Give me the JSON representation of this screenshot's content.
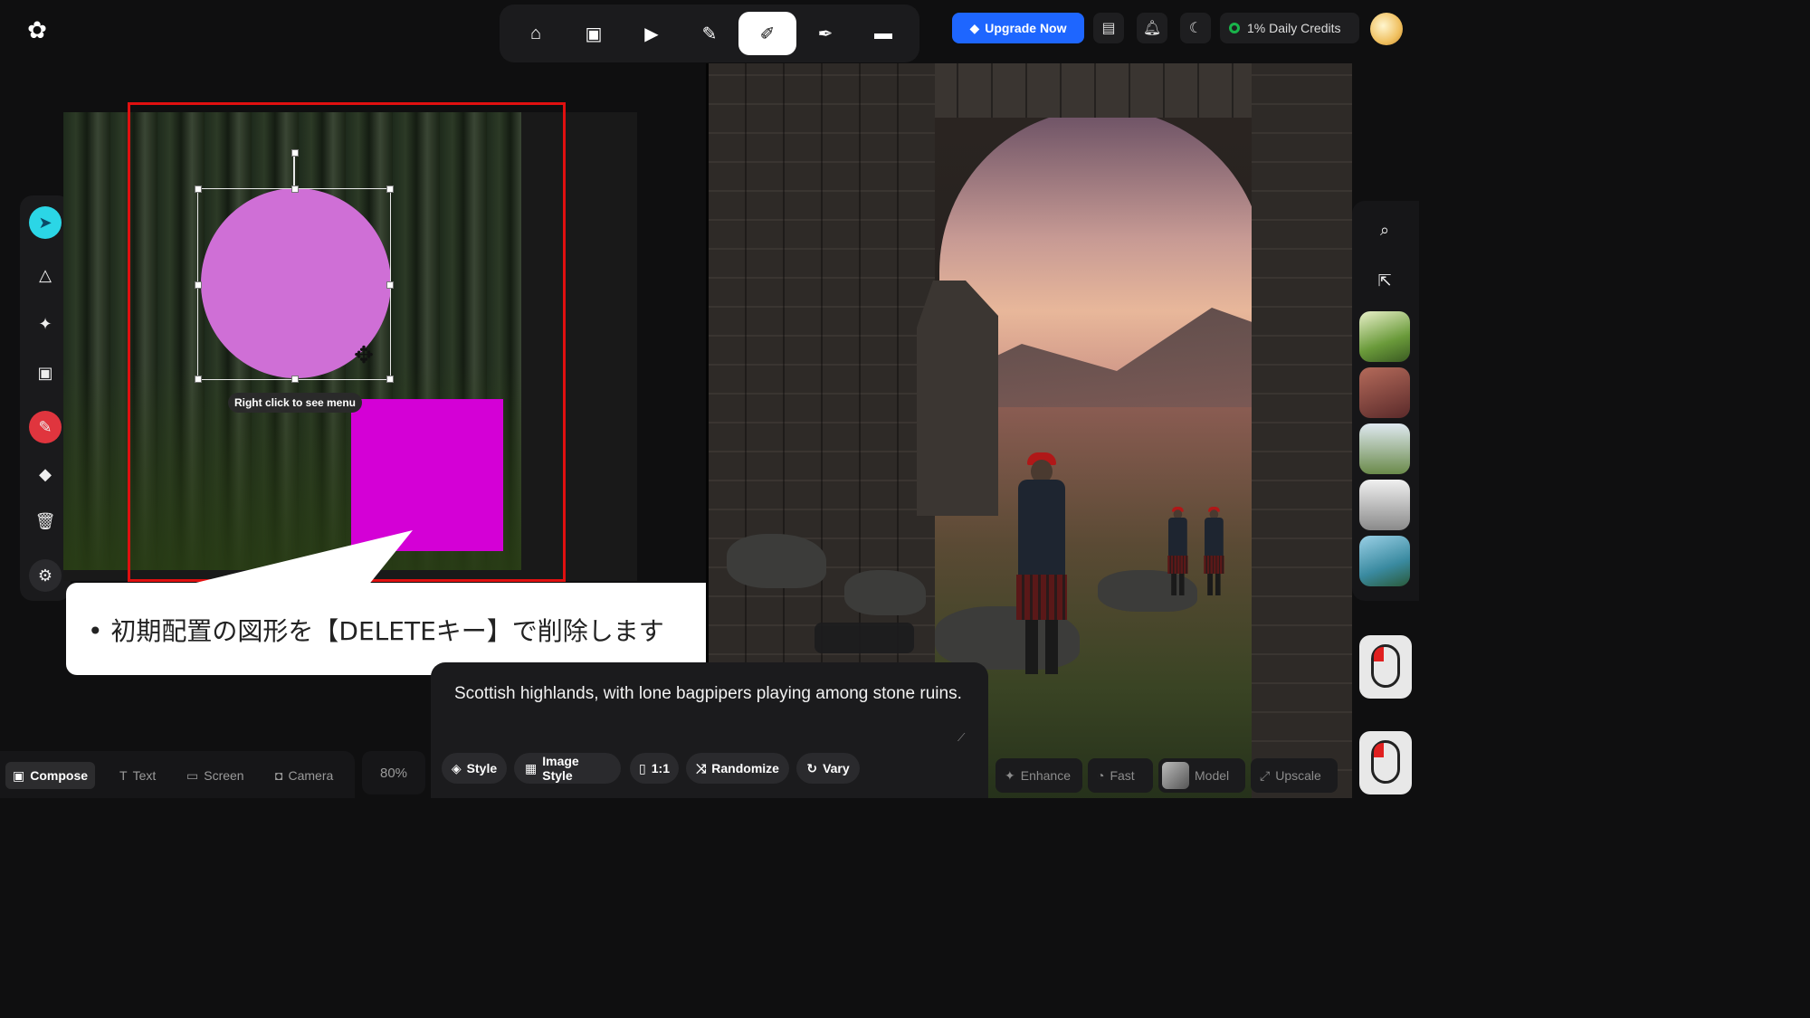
{
  "header": {
    "logo": "✿",
    "nav": [
      {
        "name": "home-icon",
        "glyph": "⌂"
      },
      {
        "name": "image-icon",
        "glyph": "▣"
      },
      {
        "name": "video-icon",
        "glyph": "▶"
      },
      {
        "name": "magic-wand-icon",
        "glyph": "✎"
      },
      {
        "name": "brush-icon",
        "glyph": "✐"
      },
      {
        "name": "pen-nib-icon",
        "glyph": "✒"
      },
      {
        "name": "folder-icon",
        "glyph": "▬"
      }
    ],
    "upgrade_label": "Upgrade Now",
    "credits_label": "1% Daily Credits"
  },
  "canvas": {
    "selection_tooltip": "Right click to see menu",
    "circle_color": "#cf6fd6",
    "square_color": "#d400d6",
    "frame_color": "#e01010"
  },
  "callout": {
    "bullet": "•",
    "text": "初期配置の図形を【DELETEキー】で削除します"
  },
  "prompt": {
    "text": "Scottish highlands, with lone bagpipers playing among stone ruins.",
    "chips": [
      {
        "label": "Style",
        "icon": "◈"
      },
      {
        "label": "Image Style",
        "icon": "▦"
      },
      {
        "label": "1:1",
        "icon": "▯"
      },
      {
        "label": "Randomize",
        "icon": "⤨"
      },
      {
        "label": "Vary",
        "icon": "↻"
      }
    ]
  },
  "bottom_left": {
    "items": [
      {
        "label": "Compose",
        "icon": "▣",
        "active": true
      },
      {
        "label": "Text",
        "icon": "T"
      },
      {
        "label": "Screen",
        "icon": "▭"
      },
      {
        "label": "Camera",
        "icon": "◘"
      }
    ],
    "zoom": "80%"
  },
  "bottom_right": {
    "enhance": "Enhance",
    "fast": "Fast",
    "model": "Model",
    "upscale": "Upscale"
  },
  "colors": {
    "accent": "#1e66ff",
    "background": "#0f0f10"
  }
}
